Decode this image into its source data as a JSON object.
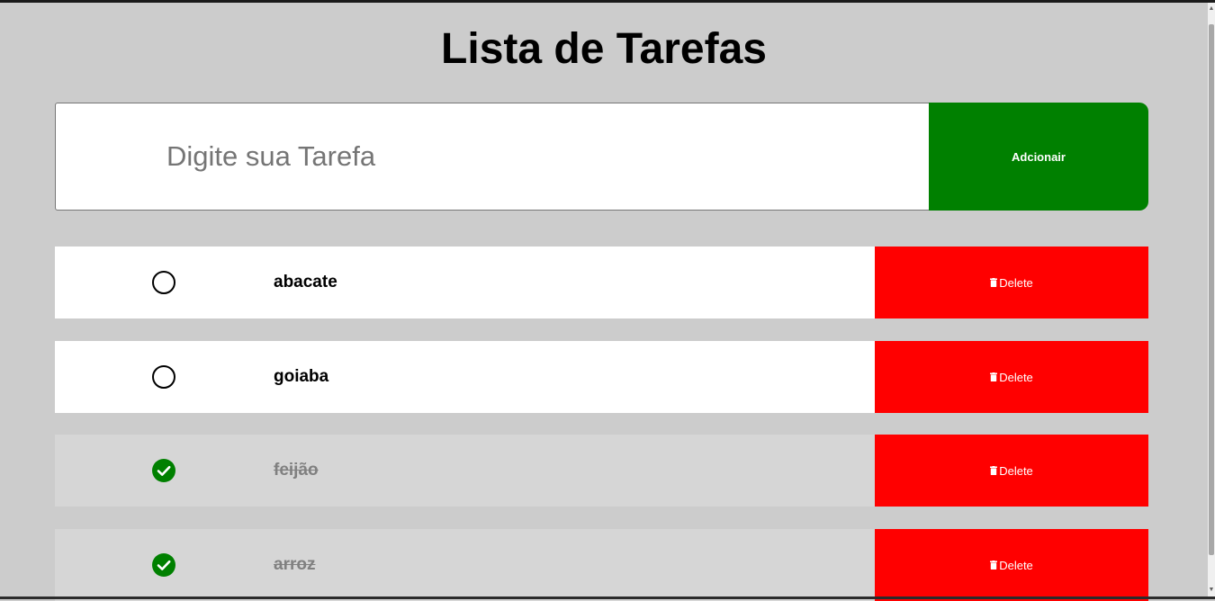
{
  "app": {
    "title": "Lista de Tarefas"
  },
  "add_form": {
    "placeholder": "Digite sua Tarefa",
    "value": "",
    "button_label": "Adcionair",
    "button_color": "#008000"
  },
  "tasks": [
    {
      "text": "abacate",
      "completed": false,
      "delete_label": "Delete"
    },
    {
      "text": "goiaba",
      "completed": false,
      "delete_label": "Delete"
    },
    {
      "text": "feijão",
      "completed": true,
      "delete_label": "Delete"
    },
    {
      "text": "arroz",
      "completed": true,
      "delete_label": "Delete"
    }
  ],
  "colors": {
    "background": "#cccccc",
    "delete": "#ff0000",
    "done_check": "#008000",
    "done_text": "#808080",
    "done_row": "#d6d6d6"
  },
  "icons": {
    "delete": "trash-icon",
    "done": "check-circle-icon",
    "todo": "circle-outline-icon"
  }
}
